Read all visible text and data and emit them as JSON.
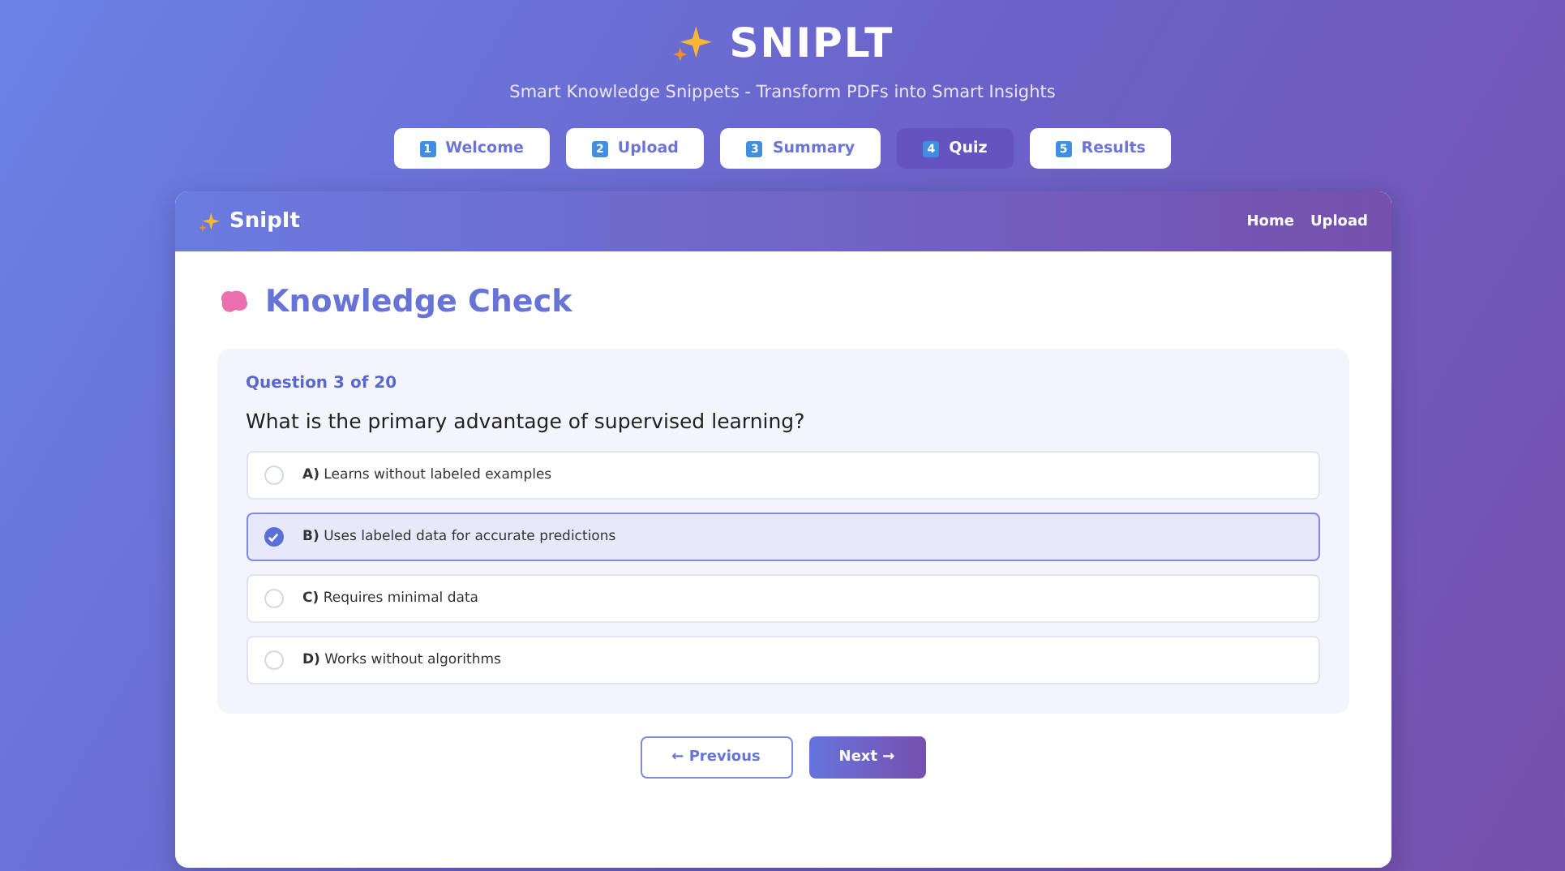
{
  "app": {
    "title": "SNIPLT",
    "tagline": "Smart Knowledge Snippets - Transform PDFs into Smart Insights"
  },
  "steps": [
    {
      "number": "1",
      "label": "Welcome",
      "selected": false
    },
    {
      "number": "2",
      "label": "Upload",
      "selected": false
    },
    {
      "number": "3",
      "label": "Summary",
      "selected": false
    },
    {
      "number": "4",
      "label": "Quiz",
      "selected": true
    },
    {
      "number": "5",
      "label": "Results",
      "selected": false
    }
  ],
  "card_header": {
    "brand": "SnipIt",
    "links": [
      "Home",
      "Upload"
    ]
  },
  "page_title": "Knowledge Check",
  "quiz": {
    "progress": "Question 3 of 20",
    "question": "What is the primary advantage of supervised learning?",
    "options": [
      {
        "text": "**A)** Learns without labeled examples",
        "selected": false
      },
      {
        "text": "**B)** Uses labeled data for accurate predictions",
        "selected": true
      },
      {
        "text": "**C)** Requires minimal data",
        "selected": false
      },
      {
        "text": "**D)** Works without algorithms",
        "selected": false
      }
    ]
  },
  "buttons": {
    "previous": "← Previous",
    "next": "Next →"
  }
}
